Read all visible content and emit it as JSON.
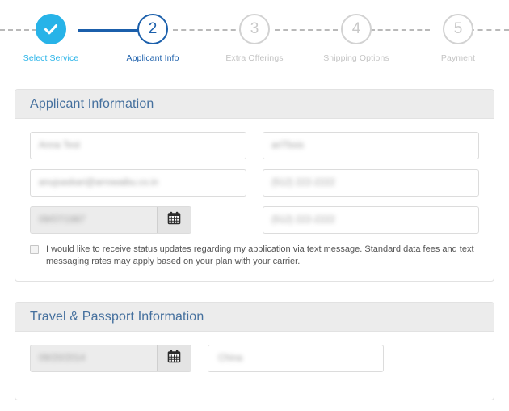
{
  "stepper": {
    "steps": [
      {
        "number": "",
        "label": "Select Service",
        "state": "done",
        "icon": "check-icon"
      },
      {
        "number": "2",
        "label": "Applicant Info",
        "state": "current",
        "icon": ""
      },
      {
        "number": "3",
        "label": "Extra Offerings",
        "state": "todo",
        "icon": ""
      },
      {
        "number": "4",
        "label": "Shipping Options",
        "state": "todo",
        "icon": ""
      },
      {
        "number": "5",
        "label": "Payment",
        "state": "todo",
        "icon": ""
      }
    ],
    "colors": {
      "done": "#27b3e8",
      "current": "#1b5fab",
      "todo": "#c9c9c9",
      "connector_complete": "#1b5fab",
      "connector_pending": "#b9b9b9"
    }
  },
  "applicant_panel": {
    "title": "Applicant Information",
    "fields": {
      "full_name": {
        "value": "Anna Test",
        "redacted": true
      },
      "middle_name": {
        "value": "ariTbsis",
        "redacted": true
      },
      "email": {
        "value": "anujsaskari@arrowaibu.co.in",
        "redacted": true
      },
      "phone_primary": {
        "value": "(512) 222-2222",
        "redacted": true
      },
      "date_of_birth": {
        "value": "09/07/1987",
        "redacted": true
      },
      "phone_secondary": {
        "value": "(512) 222-2222",
        "redacted": true
      }
    },
    "calendar_icon": "calendar-icon",
    "consent": {
      "checked": false,
      "text": "I would like to receive status updates regarding my application via text message. Standard data fees and text messaging rates may apply based on your plan with your carrier."
    }
  },
  "travel_panel": {
    "title": "Travel & Passport Information",
    "fields": {
      "travel_date": {
        "value": "09/20/2014",
        "redacted": true
      },
      "destination_country": {
        "value": "China",
        "redacted": true
      }
    },
    "calendar_icon": "calendar-icon"
  }
}
